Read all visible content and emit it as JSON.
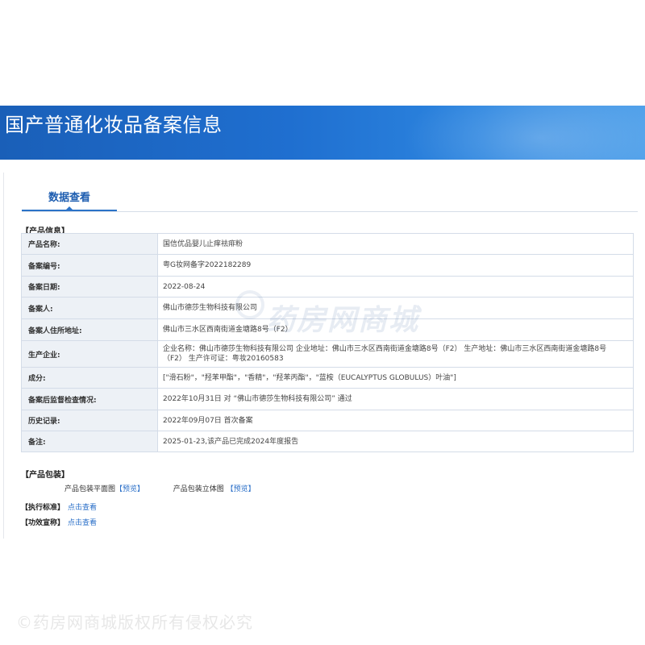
{
  "page": {
    "title": "国产普通化妆品备案信息",
    "tab_label": "数据查看"
  },
  "product_info": {
    "section_label": "【产品信息】",
    "rows": [
      {
        "key": "产品名称:",
        "value": "国信优品婴儿止痒祛痱粉"
      },
      {
        "key": "备案编号:",
        "value": "粤G妆网备字2022182289"
      },
      {
        "key": "备案日期:",
        "value": "2022-08-24"
      },
      {
        "key": "备案人:",
        "value": "佛山市德莎生物科技有限公司"
      },
      {
        "key": "备案人住所地址:",
        "value": "佛山市三水区西南街道金塘路8号（F2）"
      },
      {
        "key": "生产企业:",
        "value": "企业名称：佛山市德莎生物科技有限公司 企业地址：佛山市三水区西南街道金塘路8号（F2） 生产地址：佛山市三水区西南街道金塘路8号（F2） 生产许可证：粤妆20160583"
      },
      {
        "key": "成分:",
        "value": "[\"滑石粉\"，\"羟苯甲酯\"，\"香精\"，\"羟苯丙酯\"，\"蓝桉（EUCALYPTUS GLOBULUS）叶油\"]"
      },
      {
        "key": "备案后监督检查情况:",
        "value": "2022年10月31日 对 “佛山市德莎生物科技有限公司” 通过"
      },
      {
        "key": "历史记录:",
        "value": "2022年09月07日 首次备案"
      },
      {
        "key": "备注:",
        "value": "2025-01-23,该产品已完成2024年度报告"
      }
    ]
  },
  "packaging": {
    "section_label": "【产品包装】",
    "flat_label": "产品包装平面图",
    "flat_link": "【预览】",
    "solid_label": "产品包装立体图",
    "solid_link": "【预览】"
  },
  "standard": {
    "label": "【执行标准】",
    "link": "点击查看"
  },
  "efficacy": {
    "label": "【功效宣称】",
    "link": "点击查看"
  },
  "watermark": {
    "text": "药房网商城",
    "copyright": "©药房网商城版权所有侵权必究"
  }
}
